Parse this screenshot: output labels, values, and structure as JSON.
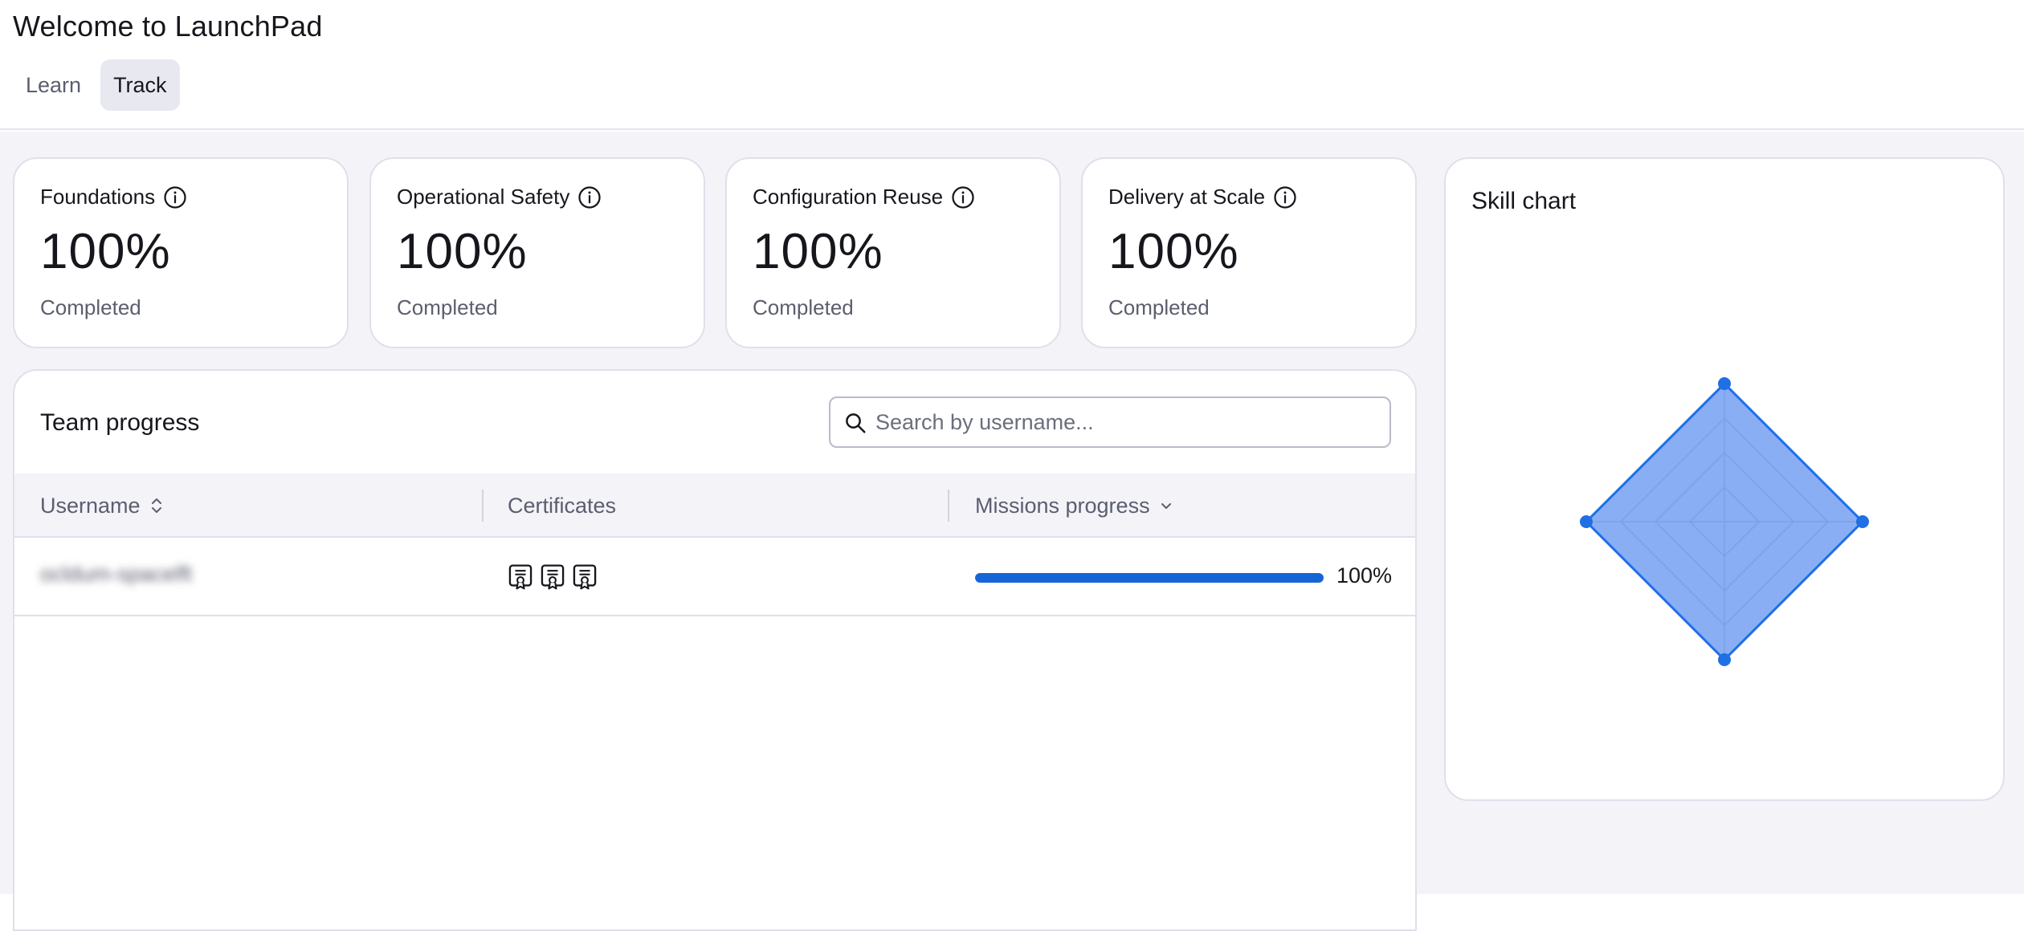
{
  "header": {
    "title": "Welcome to LaunchPad",
    "tabs": [
      {
        "label": "Learn",
        "active": false
      },
      {
        "label": "Track",
        "active": true
      }
    ]
  },
  "stats": [
    {
      "title": "Foundations",
      "value": "100%",
      "label": "Completed"
    },
    {
      "title": "Operational Safety",
      "value": "100%",
      "label": "Completed"
    },
    {
      "title": "Configuration Reuse",
      "value": "100%",
      "label": "Completed"
    },
    {
      "title": "Delivery at Scale",
      "value": "100%",
      "label": "Completed"
    }
  ],
  "team": {
    "title": "Team progress",
    "search_placeholder": "Search by username...",
    "columns": {
      "username": "Username",
      "certificates": "Certificates",
      "missions": "Missions progress"
    },
    "rows": [
      {
        "username": "ocldum-spacelft",
        "certificates": 3,
        "progress": 1.0,
        "progress_text": "100%"
      }
    ]
  },
  "skill_chart": {
    "title": "Skill chart",
    "accent_color": "#1f6fe5",
    "fill_color": "#5b8ff0",
    "axes": 4,
    "values": [
      1.0,
      1.0,
      1.0,
      1.0
    ],
    "rings": 4
  }
}
